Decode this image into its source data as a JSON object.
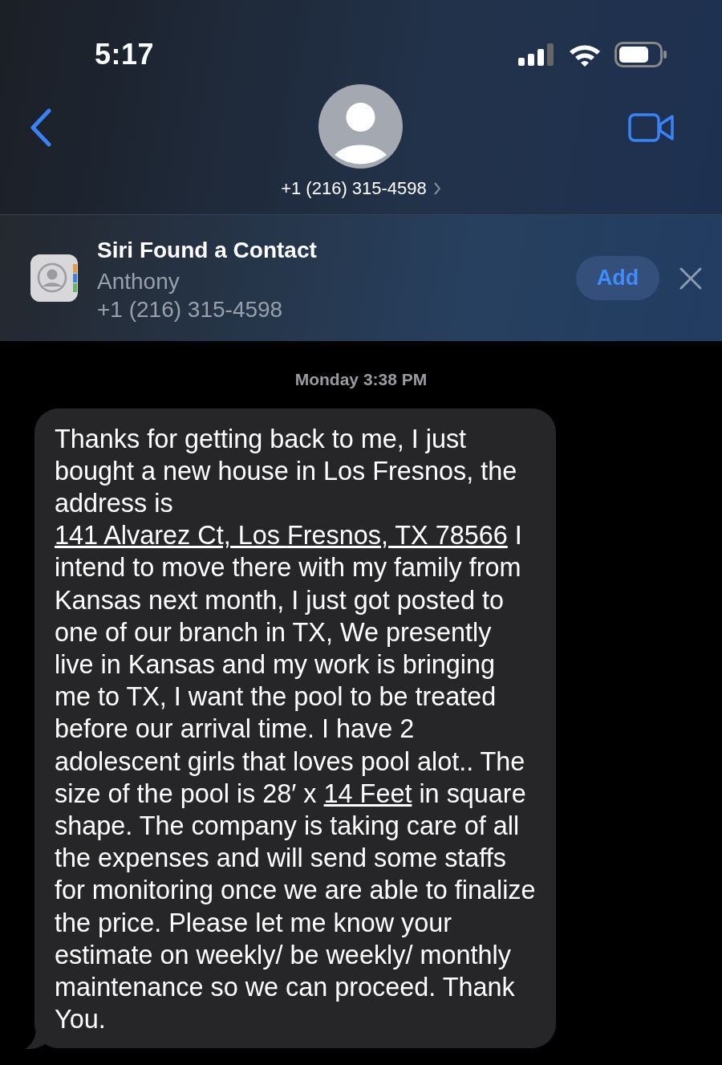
{
  "status_bar": {
    "time": "5:17"
  },
  "header": {
    "phone": "+1 (216) 315-4598"
  },
  "siri_banner": {
    "title": "Siri Found a Contact",
    "name": "Anthony",
    "phone": "+1 (216) 315-4598",
    "add_button": "Add"
  },
  "conversation": {
    "timestamp": "Monday 3:38 PM",
    "messages": [
      {
        "segments": [
          {
            "text": "Thanks for getting back to me, I just bought a new house in Los Fresnos, the address is ",
            "link": false
          },
          {
            "text": "141 Alvarez Ct, Los ",
            "link": true
          },
          {
            "text": "Fresnos, TX 78566",
            "link": true
          },
          {
            "text": " I intend to move there with my family from Kansas next month, I just got posted to one of our branch in TX, We presently live in Kansas and my work is bringing me to TX, I want the pool to be treated before our arrival time. I have 2 adolescent girls that loves pool alot.. The size of the pool is 28′ x ",
            "link": false
          },
          {
            "text": "14 Feet",
            "link": true
          },
          {
            "text": " in square shape. The company is taking care of all the expenses and will send some staffs for monitoring once we are able to finalize the price. Please let me know your estimate on weekly/ be weekly/ monthly maintenance so we can proceed. Thank You.",
            "link": false
          }
        ]
      }
    ]
  }
}
